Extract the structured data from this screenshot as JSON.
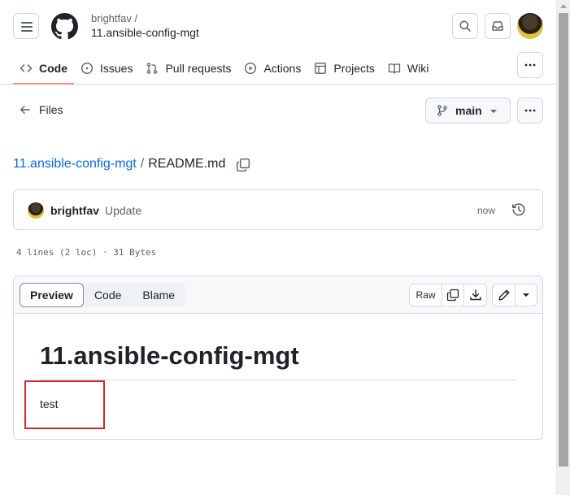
{
  "header": {
    "owner": "brightfav /",
    "repo": "11.ansible-config-mgt",
    "nav": [
      {
        "label": "Code",
        "icon": "code-icon",
        "active": true
      },
      {
        "label": "Issues",
        "icon": "issue-icon",
        "active": false
      },
      {
        "label": "Pull requests",
        "icon": "pull-request-icon",
        "active": false
      },
      {
        "label": "Actions",
        "icon": "play-icon",
        "active": false
      },
      {
        "label": "Projects",
        "icon": "table-icon",
        "active": false
      },
      {
        "label": "Wiki",
        "icon": "book-icon",
        "active": false
      }
    ]
  },
  "files_bar": {
    "files_label": "Files",
    "branch": "main"
  },
  "breadcrumb": {
    "repo_link": "11.ansible-config-mgt",
    "separator": "/",
    "file": "README.md"
  },
  "commit": {
    "author": "brightfav",
    "message": "Update",
    "time": "now"
  },
  "file_meta": "4 lines (2 loc) · 31 Bytes",
  "viewer": {
    "tabs": [
      "Preview",
      "Code",
      "Blame"
    ],
    "active_tab": "Preview",
    "raw_label": "Raw"
  },
  "readme": {
    "heading": "11.ansible-config-mgt",
    "body": "test"
  },
  "colors": {
    "link": "#0969da",
    "active_underline": "#fd8c73",
    "highlight": "#d6262f"
  }
}
